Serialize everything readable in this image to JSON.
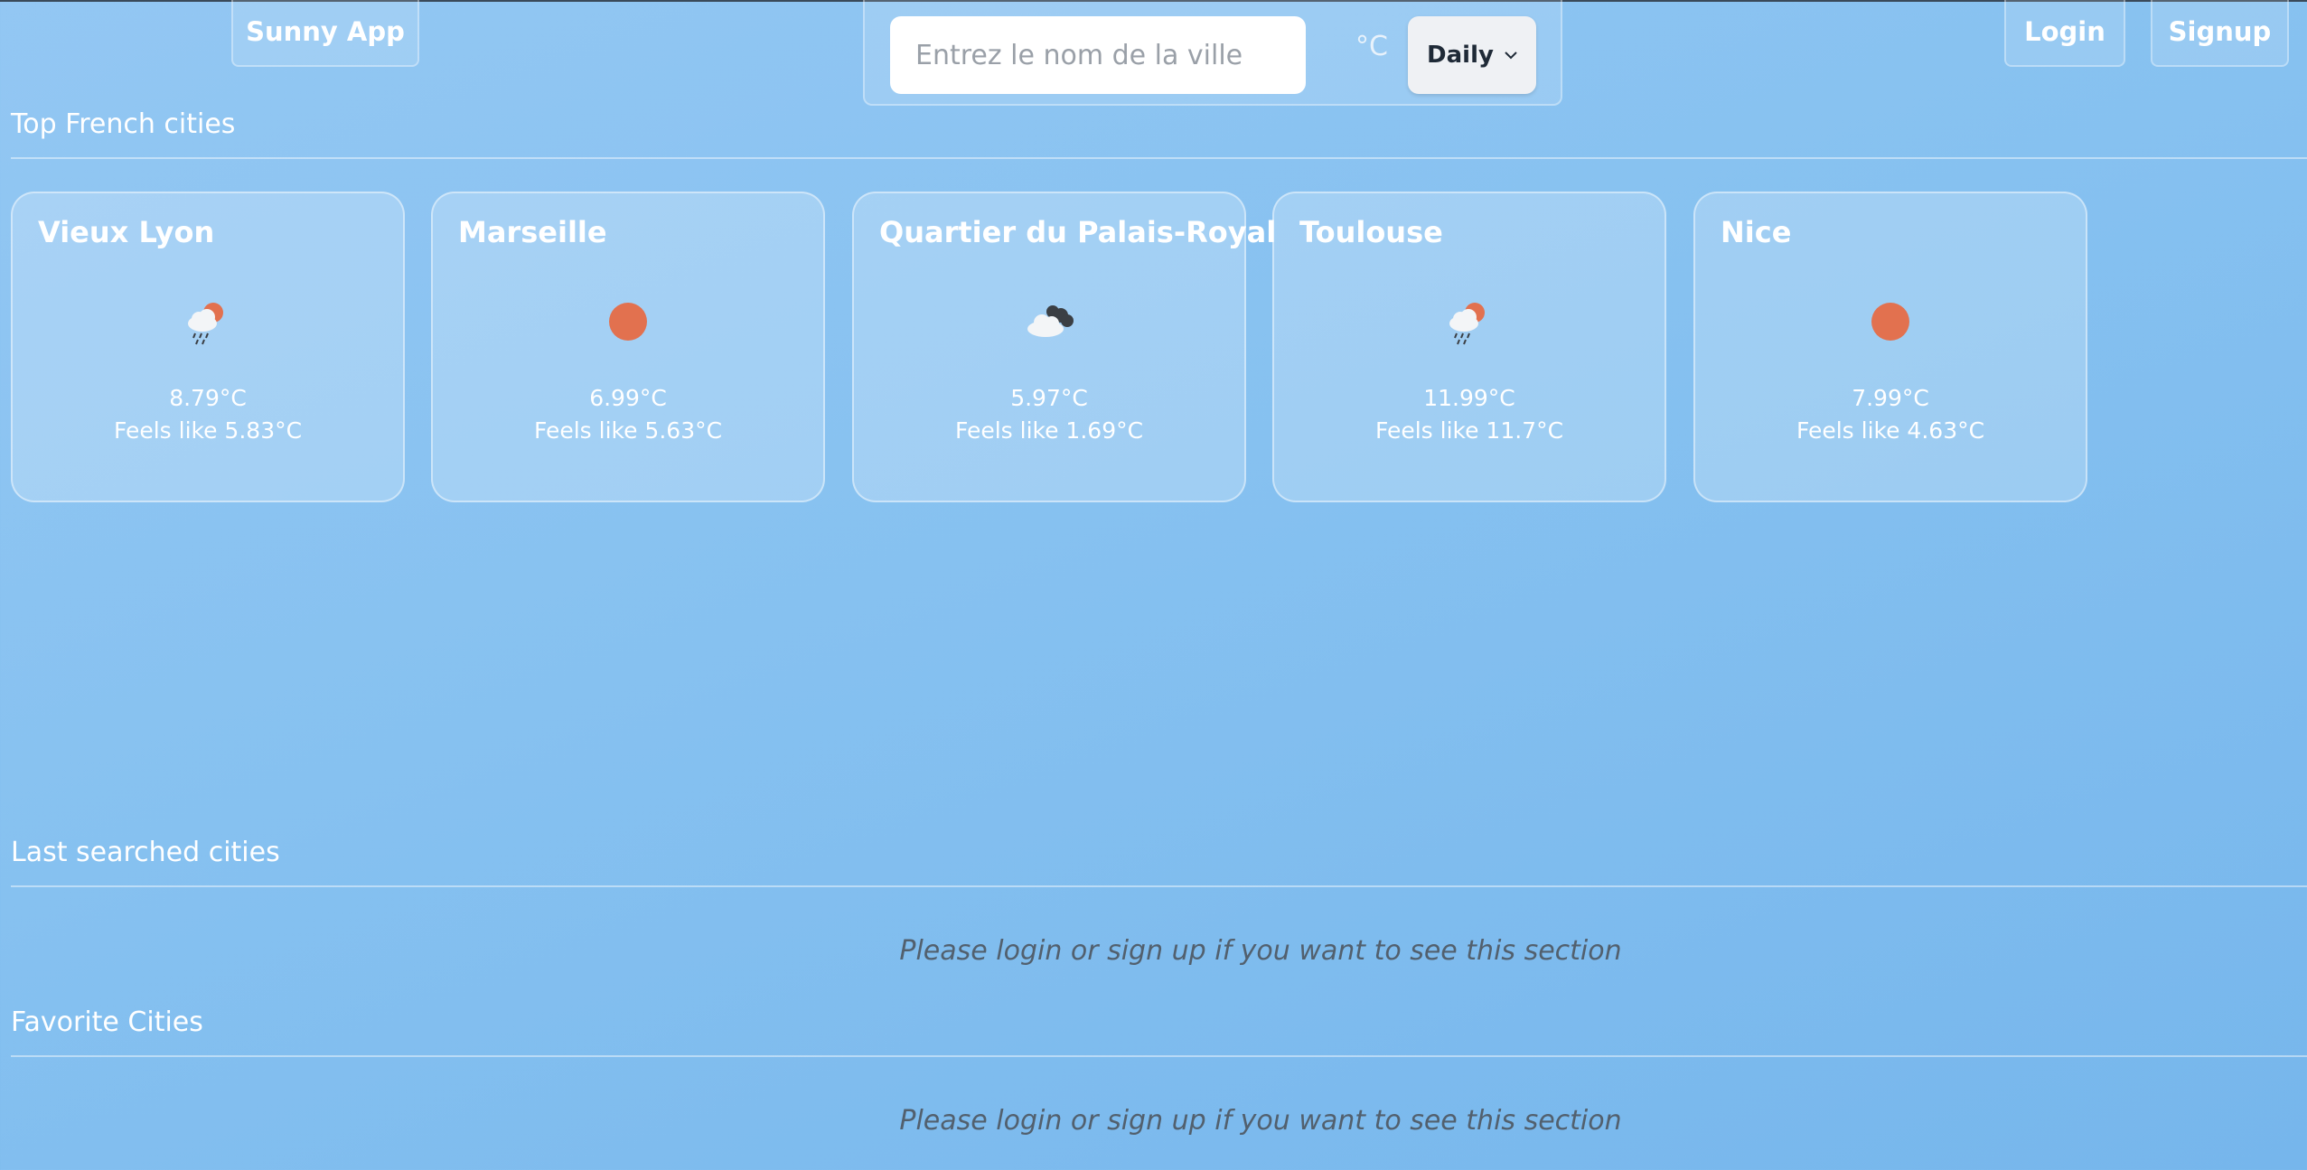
{
  "header": {
    "brand": "Sunny App",
    "search_placeholder": "Entrez le nom de la ville",
    "unit": "°C",
    "mode": "Daily",
    "login": "Login",
    "signup": "Signup"
  },
  "top_cities": {
    "title": "Top French cities",
    "cards": [
      {
        "name": "Vieux Lyon",
        "icon": "sun-cloud-rain-icon",
        "temp": "8.79°C",
        "feels": "Feels like 5.83°C"
      },
      {
        "name": "Marseille",
        "icon": "sun-icon",
        "temp": "6.99°C",
        "feels": "Feels like 5.63°C"
      },
      {
        "name": "Quartier du Palais-Royal",
        "icon": "clouds-icon",
        "temp": "5.97°C",
        "feels": "Feels like 1.69°C"
      },
      {
        "name": "Toulouse",
        "icon": "sun-cloud-rain-icon",
        "temp": "11.99°C",
        "feels": "Feels like 11.7°C"
      },
      {
        "name": "Nice",
        "icon": "sun-icon",
        "temp": "7.99°C",
        "feels": "Feels like 4.63°C"
      }
    ]
  },
  "last_searched": {
    "title": "Last searched cities",
    "notice": "Please login or sign up if you want to see this section"
  },
  "favorites": {
    "title": "Favorite Cities",
    "notice": "Please login or sign up if you want to see this section"
  },
  "colors": {
    "sun": "#e2714f",
    "cloud_light": "#f3f5f7",
    "cloud_dark": "#3b3f44"
  }
}
